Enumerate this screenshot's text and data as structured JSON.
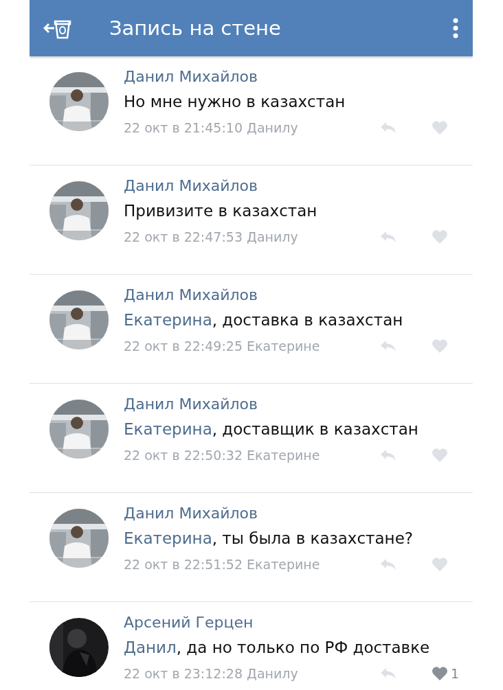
{
  "header": {
    "title": "Запись на стене"
  },
  "comments": [
    {
      "author": "Данил Михайлов",
      "text": "Но мне нужно в казахстан",
      "time": "22 окт в 21:45:10 Данилу"
    },
    {
      "author": "Данил Михайлов",
      "text": "Привизите в казахстан",
      "time": "22 окт в 22:47:53 Данилу"
    },
    {
      "author": "Данил Михайлов",
      "mention": "Екатерина",
      "text": ", доставка в казахстан",
      "time": "22 окт в 22:49:25 Екатерине"
    },
    {
      "author": "Данил Михайлов",
      "mention": "Екатерина",
      "text": ", доставщик в казахстан",
      "time": "22 окт в 22:50:32 Екатерине"
    },
    {
      "author": "Данил Михайлов",
      "mention": "Екатерина",
      "text": ", ты была в казахстане?",
      "time": "22 окт в 22:51:52 Екатерине"
    },
    {
      "author": "Арсений Герцен",
      "mention": "Данил",
      "text": ", да но только по РФ доставке",
      "time": "22 окт в 23:12:28 Данилу",
      "likes": "1"
    }
  ]
}
